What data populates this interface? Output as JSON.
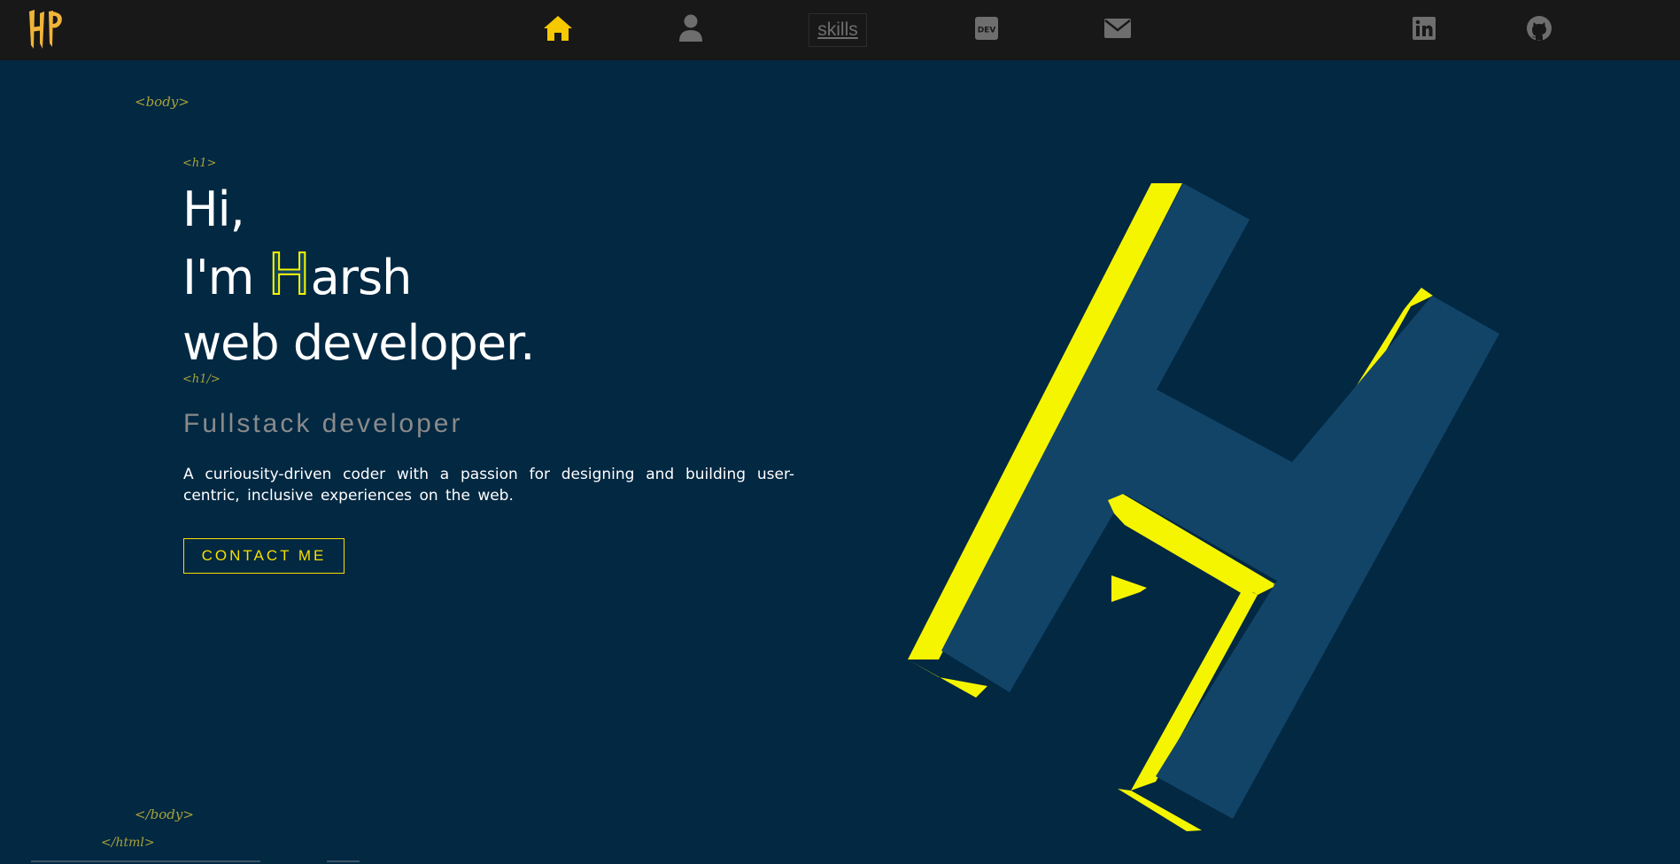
{
  "nav": {
    "logo_text": "HP",
    "skills_label": "skills",
    "icons": {
      "home": "home-icon",
      "about": "user-icon",
      "dev": "dev-icon",
      "mail": "envelope-icon",
      "linkedin": "linkedin-icon",
      "github": "github-icon"
    },
    "dev_label": "DEV",
    "linkedin_label": "in"
  },
  "tags": {
    "body_open": "<body>",
    "h1_open": "<h1>",
    "h1_close": "<h1/>",
    "body_close": "</body>",
    "html_close": "</html>"
  },
  "hero": {
    "line1": "Hi,",
    "line2_prefix": "I'm ",
    "line2_initial": "H",
    "line2_rest": "arsh",
    "line3": "web developer.",
    "subtitle": "Fullstack developer",
    "description": "A curiousity-driven coder with a passion for designing and building user-centric, inclusive experiences on the web.",
    "cta_label": "CONTACT ME"
  },
  "colors": {
    "background": "#022842",
    "navbar": "#181818",
    "accent_yellow": "#f6f500",
    "logo_blue": "#124468",
    "active_icon": "#f6c800",
    "inactive_icon": "#6e6e6e"
  }
}
